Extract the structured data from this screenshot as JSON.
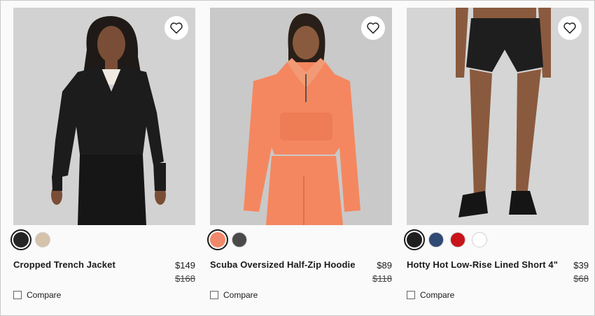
{
  "products": [
    {
      "name": "Cropped Trench Jacket",
      "price": "$149",
      "original_price": "$168",
      "image_icon": "black-jacket-photo",
      "swatches": [
        {
          "color": "#262626",
          "selected": true
        },
        {
          "color": "#d6c3ab",
          "selected": false
        }
      ],
      "compare_label": "Compare"
    },
    {
      "name": "Scuba Oversized Half-Zip Hoodie",
      "price": "$89",
      "original_price": "$118",
      "image_icon": "coral-hoodie-photo",
      "swatches": [
        {
          "color": "#f2886a",
          "selected": true
        },
        {
          "color": "#4a4a4a",
          "selected": false
        }
      ],
      "compare_label": "Compare"
    },
    {
      "name": "Hotty Hot Low-Rise Lined Short 4\"",
      "price": "$39",
      "original_price": "$68",
      "image_icon": "black-shorts-photo",
      "swatches": [
        {
          "color": "#1f1f1f",
          "selected": true
        },
        {
          "color": "#2f4a73",
          "selected": false
        },
        {
          "color": "#c8141b",
          "selected": false
        },
        {
          "color": "#ffffff",
          "selected": false
        }
      ],
      "compare_label": "Compare"
    }
  ],
  "wishlist_icon": "heart-icon",
  "colors": {
    "photo_bg": "#d3d3d3",
    "text": "#1a1a1a"
  }
}
